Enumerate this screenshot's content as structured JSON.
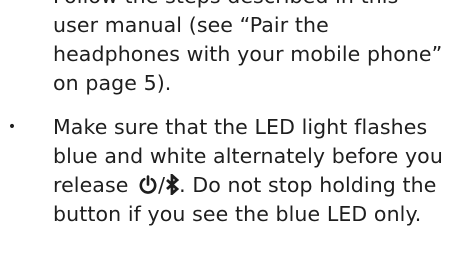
{
  "bullet_symbol": "•",
  "items": [
    {
      "text": "Follow the steps described in this user manual (see “Pair the headphones with your mobile phone” on page 5)."
    },
    {
      "text_before": "Make sure that the LED light flashes blue and white alternately before you release ",
      "icon_power": "power-icon",
      "separator": "/",
      "icon_bluetooth": "bluetooth-icon",
      "text_after": ". Do not stop holding the button if you see the blue LED only."
    }
  ]
}
